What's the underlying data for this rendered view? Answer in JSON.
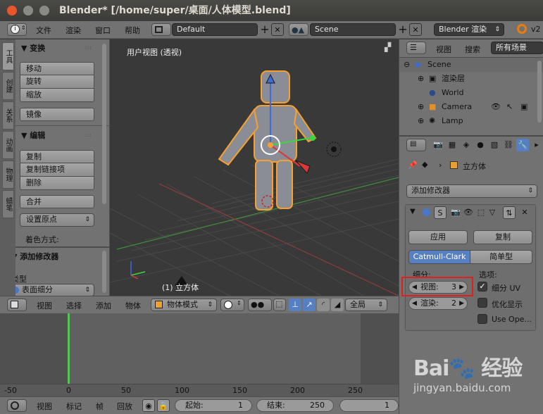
{
  "window": {
    "title": "Blender* [/home/super/桌面/人体模型.blend]"
  },
  "top_menu": {
    "items": [
      "文件",
      "渲染",
      "窗口",
      "帮助"
    ],
    "layout": "Default",
    "scene": "Scene",
    "engine": "Blender 渲染",
    "version": "v2"
  },
  "tool_tabs": [
    "工具",
    "创建",
    "关系",
    "动画",
    "物理",
    "蜡笔"
  ],
  "tool_panel": {
    "transform_title": "▼ 变换",
    "transform_buttons": [
      "移动",
      "旋转",
      "缩放"
    ],
    "mirror": "镜像",
    "edit_title": "▼ 编辑",
    "edit_buttons": [
      "复制",
      "复制链接项",
      "删除"
    ],
    "join": "合并",
    "set_origin": "设置原点",
    "shading_label": "着色方式:",
    "operator_title": "▼ 添加修改器",
    "type_label": "类型",
    "type_value": "表面细分"
  },
  "viewport": {
    "view_label": "用户视图 (透视)",
    "object_label": "(1) 立方体"
  },
  "viewport_header": {
    "items": [
      "视图",
      "选择",
      "添加",
      "物体"
    ],
    "mode": "物体模式",
    "pivot": "全局"
  },
  "timeline": {
    "ticks": [
      "-50",
      "0",
      "50",
      "100",
      "150",
      "200",
      "250"
    ],
    "current_frame": 1
  },
  "timeline_header": {
    "items": [
      "视图",
      "标记",
      "帧",
      "回放"
    ],
    "start_label": "起始:",
    "start_value": "1",
    "end_label": "结束:",
    "end_value": "250",
    "current_value": "1"
  },
  "outliner": {
    "header_items": [
      "视图",
      "搜索"
    ],
    "filter": "所有场景",
    "rows": [
      {
        "label": "Scene",
        "indent": 0
      },
      {
        "label": "渲染层",
        "indent": 1
      },
      {
        "label": "World",
        "indent": 1
      },
      {
        "label": "Camera",
        "indent": 1
      },
      {
        "label": "Lamp",
        "indent": 1
      }
    ]
  },
  "properties": {
    "object_name": "立方体",
    "add_modifier": "添加修改器",
    "apply": "应用",
    "copy": "复制",
    "tab_catmull": "Catmull-Clark",
    "tab_simple": "简单型",
    "subdiv_label": "细分:",
    "options_label": "选项:",
    "view_label": "视图:",
    "view_value": "3",
    "render_label": "渲染:",
    "render_value": "2",
    "opt_uv": "细分 UV",
    "opt_optimal": "优化显示",
    "opt_opensubdiv": "Use Ope..."
  },
  "watermark": {
    "text": "jingyan.baidu.com"
  },
  "colors": {
    "accent_blue": "#5680c2",
    "highlight_red": "#e02020",
    "select_orange": "#f5a030"
  }
}
